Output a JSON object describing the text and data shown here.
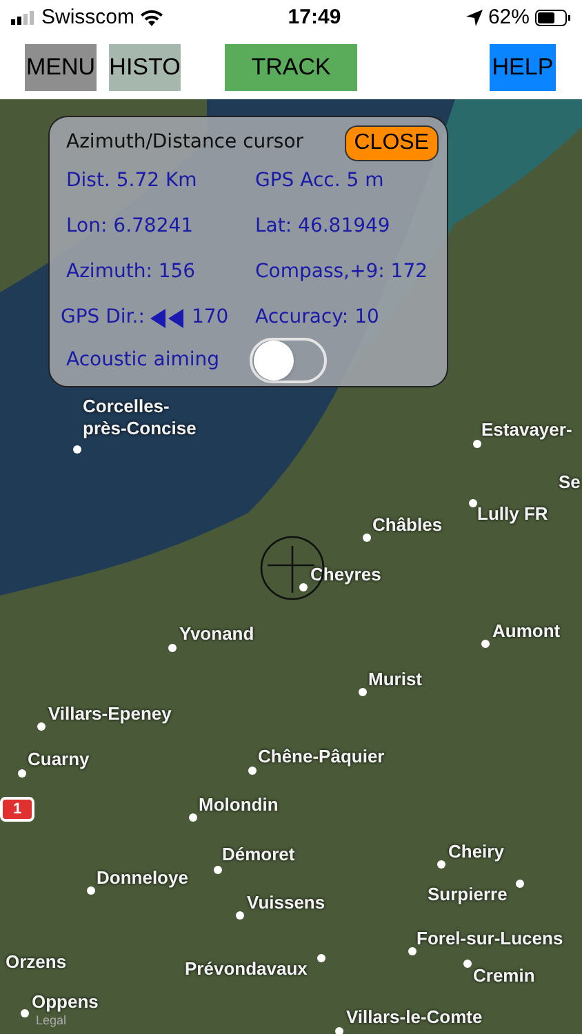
{
  "status_bar": {
    "carrier": "Swisscom",
    "time": "17:49",
    "battery": "62%"
  },
  "toolbar": [
    {
      "label": "MENU",
      "color": "#8e8e8e"
    },
    {
      "label": "HISTO",
      "color": "#a6b8ae"
    },
    {
      "label": "TRACK",
      "color": "#5aac5a"
    },
    {
      "label": "HELP",
      "color": "#0a84ff"
    }
  ],
  "cursor_panel": {
    "title": "Azimuth/Distance cursor",
    "close_button": "CLOSE",
    "rows": [
      [
        {
          "kind": "text",
          "text": "Dist. 5.72 Km"
        },
        {
          "kind": "text",
          "text": "GPS Acc. 5 m"
        }
      ],
      [
        {
          "kind": "text",
          "text": "Lon: 6.78241"
        },
        {
          "kind": "text",
          "text": "Lat: 46.81949"
        }
      ],
      [
        {
          "kind": "text",
          "text": "Azimuth: 156"
        },
        {
          "kind": "text",
          "text": "Compass,+9: 172"
        }
      ],
      [
        {
          "kind": "direction",
          "label": "GPS Dir.:",
          "value": "170"
        },
        {
          "kind": "text",
          "text": "Accuracy: 10"
        }
      ]
    ],
    "toggle": {
      "label": "Acoustic aiming",
      "on": false
    }
  },
  "map": {
    "places": [
      "Corcelles-près-Concise",
      "Estavayer-",
      "Se",
      "Châbles",
      "Lully FR",
      "Cheyres",
      "Yvonand",
      "Aumont",
      "Murist",
      "Villars-Epeney",
      "Cuarny",
      "Chêne-Pâquier",
      "Molondin",
      "Démoret",
      "Donneloye",
      "Vuissens",
      "Cheiry",
      "Surpierre",
      "Forel-sur-Lucens",
      "Cremin",
      "Orzens",
      "Prévondavaux",
      "Oppens",
      "Villars-le-Comte"
    ],
    "road_shield": "1",
    "legal": "Legal"
  }
}
